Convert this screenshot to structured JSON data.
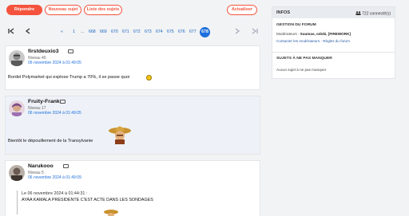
{
  "toolbar": {
    "reply_label": "Répondre",
    "new_topic_label": "Nouveau sujet",
    "topic_list_label": "Liste des sujets",
    "refresh_label": "Actualiser"
  },
  "pagination": {
    "first": "⏮",
    "prev": "‹",
    "next": "›",
    "last": "⏭",
    "pages": [
      "«",
      "1",
      "...",
      "668",
      "669",
      "670",
      "671",
      "672",
      "673",
      "674",
      "675",
      "676",
      "677",
      "678"
    ],
    "current": "678"
  },
  "posts": [
    {
      "author": "firstdeuxio3",
      "level": "Niveau 40",
      "date": "06 novembre 2024 à 01:49:05",
      "message": "Bordel Polymarket qui explose Trump a 70%, il se passe quoi"
    },
    {
      "author": "Fruity-Frank",
      "level": "Niveau 17",
      "date": "06 novembre 2024 à 01:49:05",
      "message": "Bientôt le dépouillement de la Transylvanie"
    },
    {
      "author": "Narukooo",
      "level": "Niveau 5",
      "date": "06 novembre 2024 à 01:49:09",
      "quote_header": "Le 06 novembre 2024 à 01:44:31 :",
      "quote_text": "AYAA KAMALA PRESIDENTE C'EST ACTE DANS LES SONDAGES"
    }
  ],
  "sidebar": {
    "title": "INFOS",
    "connected": "722 connecté(s)",
    "section1_title": "GESTION DU FORUM",
    "moderators_label": "Modérateurs :",
    "moderators": "Suumas, odoki, [FIREWORK]",
    "contact_link": "Contacter les modérateurs",
    "rules_link": "Règles du forum",
    "section2_title": "SUJETS À NE PAS MANQUER",
    "no_topic": "Aucun sujet à ne pas manquer"
  },
  "colors": {
    "accent": "#f5533d",
    "link": "#1e6fdc",
    "current_page": "#1e6fdc"
  }
}
